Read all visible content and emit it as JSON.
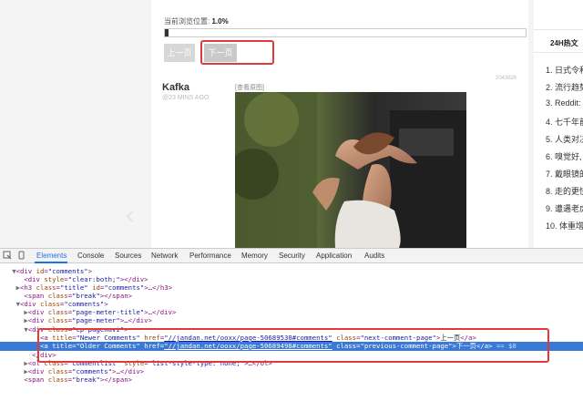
{
  "page": {
    "progress": {
      "label": "当前浏览位置:",
      "value_text": "1.0%",
      "fraction": 0.01
    },
    "pagination": {
      "prev_label": "上一页",
      "next_label": "下一页"
    },
    "post": {
      "author": "Kafka",
      "time": "@23 MINS AGO",
      "view_original": "[查看原图]",
      "comment_id": "2043826"
    },
    "sidebar": {
      "title": "24H热文",
      "items": [
        "1. 日式令和",
        "2. 流行趋势",
        "3. Reddit:",
        "4. 七千年前",
        "5. 人类对决",
        "6. 嗅觉好,",
        "7. 戴眼镜的",
        "8. 走的更快",
        "9. 遭遇老虎",
        "10. 体重增加"
      ]
    }
  },
  "devtools": {
    "tabs": [
      "Elements",
      "Console",
      "Sources",
      "Network",
      "Performance",
      "Memory",
      "Security",
      "Application",
      "Audits"
    ],
    "active_tab": "Elements",
    "lines": {
      "l1": {
        "tri": "▼",
        "open": "<div ",
        "a1": "id",
        "v1": "\"comments\"",
        "close": ">"
      },
      "l2": {
        "open": "<div ",
        "a1": "style",
        "v1": "\"clear:both;\"",
        "close": "></div>"
      },
      "l3": {
        "tri": "▶",
        "open": "<h3 ",
        "a1": "class",
        "v1": "\"title\"",
        "a2": "id",
        "v2": "\"comments\"",
        "close": ">…</h3>"
      },
      "l4": {
        "open": "<span ",
        "a1": "class",
        "v1": "\"break\"",
        "close": "></span>"
      },
      "l5": {
        "tri": "▼",
        "open": "<div ",
        "a1": "class",
        "v1": "\"comments\"",
        "close": ">"
      },
      "l6": {
        "tri": "▶",
        "open": "<div ",
        "a1": "class",
        "v1": "\"page-meter-title\"",
        "close": ">…</div>"
      },
      "l7": {
        "tri": "▶",
        "open": "<div ",
        "a1": "class",
        "v1": "\"page-meter\"",
        "close": ">…</div>"
      },
      "l8": {
        "tri": "▼",
        "open": "<div ",
        "a1": "class",
        "v1": "\"cp-pagenavi\"",
        "close": ">"
      },
      "l9": {
        "open": "<a ",
        "a1": "title",
        "v1": "\"Newer Comments\"",
        "a2": "href",
        "v2": "\"//jandan.net/ooxx/page-50689530#comments\"",
        "a3": "class",
        "v3": "\"next-comment-page\"",
        "text": "上一页",
        "close": "</a>"
      },
      "l10": {
        "open": "<a ",
        "a1": "title",
        "v1": "\"Older Comments\"",
        "a2": "href",
        "v2": "\"//jandan.net/ooxx/page-50689498#comments\"",
        "a3": "class",
        "v3": "\"previous-comment-page\"",
        "text": "下一页",
        "close": "</a>",
        "eq": "== $0"
      },
      "l11": {
        "close": "</div>"
      },
      "l12": {
        "tri": "▶",
        "open": "<ol ",
        "a1": "class",
        "v1": "\"commentlist\"",
        "a2": "style",
        "v2": "\"list-style-type: none;\"",
        "close": ">…</ol>"
      },
      "l13": {
        "tri": "▶",
        "open": "<div ",
        "a1": "class",
        "v1": "\"comments\"",
        "close": ">…</div>"
      },
      "l14": {
        "open": "<span ",
        "a1": "class",
        "v1": "\"break\"",
        "close": "></span>"
      }
    }
  },
  "colors": {
    "highlight_red": "#e23a3a",
    "selection_blue": "#3b79d6",
    "devtools_active_tab": "#1a73e8"
  }
}
